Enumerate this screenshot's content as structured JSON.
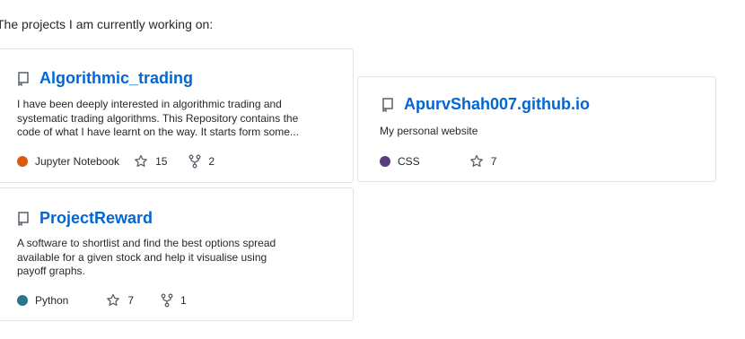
{
  "intro_text": "The projects I am currently working on:",
  "colors": {
    "link": "#0366d6",
    "jupyter": "#DA5B0B",
    "css": "#563d7c",
    "python": "#2b7489"
  },
  "repos": [
    {
      "name": "Algorithmic_trading",
      "description_lines": [
        "I have been deeply interested in algorithmic trading and",
        "systematic trading algorithms. This Repository contains the",
        "code of what I have learnt on the way. It starts form some..."
      ],
      "language": "Jupyter Notebook",
      "stars": "15",
      "forks": "2"
    },
    {
      "name": "ApurvShah007.github.io",
      "description_lines": [
        "My personal website"
      ],
      "language": "CSS",
      "stars": "7"
    },
    {
      "name": "ProjectReward",
      "description_lines": [
        "A software to shortlist and find the best options spread",
        "available for a given stock and help it visualise using",
        "payoff graphs."
      ],
      "language": "Python",
      "stars": "7",
      "forks": "1"
    }
  ]
}
